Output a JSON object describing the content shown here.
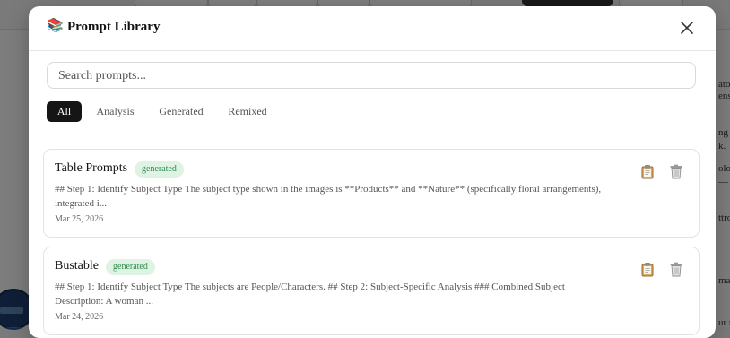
{
  "background": {
    "side_texts": [
      "atog",
      "ens",
      "ng tw",
      "k.",
      "olor",
      "— t",
      "ttro",
      "ma",
      "ur re"
    ]
  },
  "modal": {
    "title_icon": "📚",
    "title": "Prompt Library",
    "close_icon": "close-icon"
  },
  "search": {
    "placeholder": "Search prompts...",
    "value": ""
  },
  "tabs": [
    {
      "label": "All",
      "active": true
    },
    {
      "label": "Analysis",
      "active": false
    },
    {
      "label": "Generated",
      "active": false
    },
    {
      "label": "Remixed",
      "active": false
    }
  ],
  "prompts": [
    {
      "title": "Table Prompts",
      "badge": "generated",
      "description": "## Step 1: Identify Subject Type The subject type shown in the images is **Products** and **Nature** (specifically floral arrangements), integrated i...",
      "date": "Mar 25, 2026",
      "copy_icon": "clipboard-icon",
      "delete_icon": "trash-icon"
    },
    {
      "title": "Bustable",
      "badge": "generated",
      "description": "## Step 1: Identify Subject Type The subjects are People/Characters. ## Step 2: Subject-Specific Analysis ### Combined Subject Description: A woman ...",
      "date": "Mar 24, 2026",
      "copy_icon": "clipboard-icon",
      "delete_icon": "trash-icon"
    }
  ],
  "colors": {
    "badge_text": "#2f8a4a",
    "badge_bg": "#dff3e5",
    "active_tab_bg": "#151515"
  }
}
